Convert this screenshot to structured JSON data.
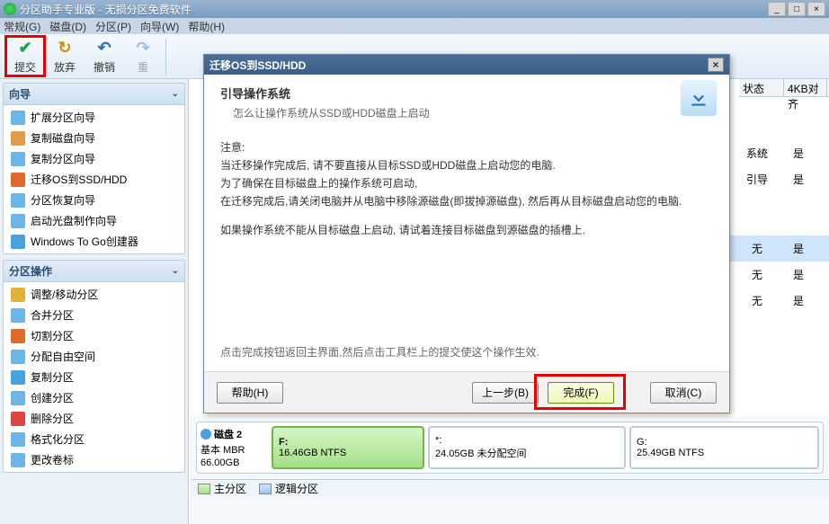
{
  "app": {
    "title": "分区助手专业版 - 无损分区免费软件"
  },
  "menu": [
    "常规(G)",
    "磁盘(D)",
    "分区(P)",
    "向导(W)",
    "帮助(H)"
  ],
  "toolbar": {
    "submit": "提交",
    "abandon": "放弃",
    "undo": "撤销",
    "redo": "重"
  },
  "panel_wizard": {
    "title": "向导",
    "items": [
      "扩展分区向导",
      "复制磁盘向导",
      "复制分区向导",
      "迁移OS到SSD/HDD",
      "分区恢复向导",
      "启动光盘制作向导",
      "Windows To Go创建器"
    ]
  },
  "panel_ops": {
    "title": "分区操作",
    "items": [
      "调整/移动分区",
      "合并分区",
      "切割分区",
      "分配自由空间",
      "复制分区",
      "创建分区",
      "删除分区",
      "格式化分区",
      "更改卷标"
    ]
  },
  "list_header": {
    "status": "状态",
    "align": "4KB对齐"
  },
  "list_rows": [
    {
      "status": "系统",
      "align": "是"
    },
    {
      "status": "引导",
      "align": "是"
    },
    {
      "status": "无",
      "align": "是"
    },
    {
      "status": "无",
      "align": "是"
    },
    {
      "status": "无",
      "align": "是"
    }
  ],
  "disk2": {
    "name": "磁盘 2",
    "type": "基本 MBR",
    "size": "66.00GB",
    "parts": [
      {
        "letter": "F:",
        "size": "16.46GB NTFS",
        "style": "green"
      },
      {
        "letter": "*:",
        "size": "24.05GB 未分配空间",
        "style": "plain"
      },
      {
        "letter": "G:",
        "size": "25.49GB NTFS",
        "style": "plain"
      }
    ]
  },
  "legend": {
    "primary": "主分区",
    "logical": "逻辑分区"
  },
  "modal": {
    "title": "迁移OS到SSD/HDD",
    "heading": "引导操作系统",
    "sub": "怎么让操作系统从SSD或HDD磁盘上启动",
    "notice_label": "注意:",
    "n1": "当迁移操作完成后, 请不要直接从目标SSD或HDD磁盘上启动您的电脑.",
    "n2": "为了确保在目标磁盘上的操作系统可启动,",
    "n3": "在迁移完成后,请关闭电脑并从电脑中移除源磁盘(即拔掉源磁盘), 然后再从目标磁盘启动您的电脑.",
    "n4": "如果操作系统不能从目标磁盘上启动, 请试着连接目标磁盘到源磁盘的插槽上.",
    "footer_note": "点击完成按钮返回主界面,然后点击工具栏上的提交使这个操作生效.",
    "btn_help": "帮助(H)",
    "btn_prev": "上一步(B)",
    "btn_finish": "完成(F)",
    "btn_cancel": "取消(C)"
  }
}
